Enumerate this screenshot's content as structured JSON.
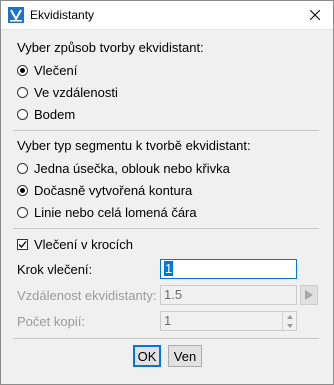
{
  "window": {
    "title": "Ekvidistanty",
    "app_icon": "app-logo-icon",
    "close_icon": "close-icon"
  },
  "method": {
    "heading": "Vyber způsob tvorby ekvidistant:",
    "options": [
      {
        "label": "Vlečení",
        "checked": true
      },
      {
        "label": "Ve vzdálenosti",
        "checked": false
      },
      {
        "label": "Bodem",
        "checked": false
      }
    ]
  },
  "segment": {
    "heading": "Vyber typ segmentu k tvorbě ekvidistant:",
    "options": [
      {
        "label": "Jedna úsečka, oblouk nebo křivka",
        "checked": false
      },
      {
        "label": "Dočasně vytvořená kontura",
        "checked": true
      },
      {
        "label": "Linie nebo celá lomená čára",
        "checked": false
      }
    ]
  },
  "drag_steps": {
    "label": "Vlečení v krocích",
    "checked": true
  },
  "fields": {
    "step_label": "Krok vlečení:",
    "step_value": "1",
    "distance_label": "Vzdálenost ekvidistanty:",
    "distance_value": "1.5",
    "copies_label": "Počet kopií:",
    "copies_value": "1"
  },
  "buttons": {
    "ok": "OK",
    "cancel": "Ven"
  },
  "colors": {
    "accent": "#0078d7",
    "dialog_bg": "#f0f0f0"
  }
}
